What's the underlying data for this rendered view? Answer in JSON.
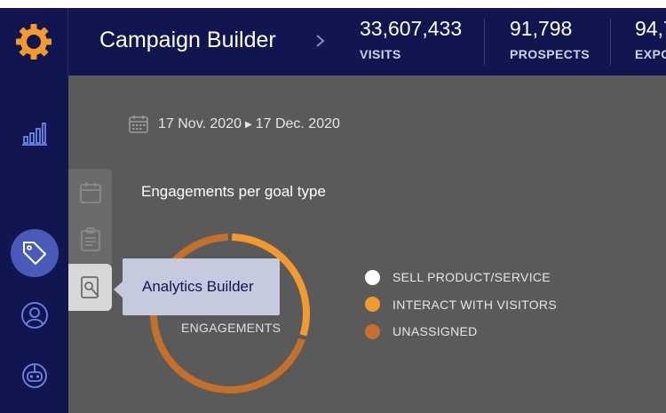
{
  "header": {
    "title": "Campaign Builder",
    "stats": [
      {
        "value": "33,607,433",
        "label": "VISITS"
      },
      {
        "value": "91,798",
        "label": "PROSPECTS"
      },
      {
        "value": "94,7",
        "label": "EXPO"
      }
    ]
  },
  "sidebar": {
    "items": [
      {
        "icon": "bar-chart-icon"
      },
      {
        "icon": "bot-user-icon"
      },
      {
        "icon": "tag-icon",
        "active": true
      },
      {
        "icon": "user-circle-icon"
      },
      {
        "icon": "robot-icon"
      }
    ]
  },
  "subnav": {
    "items": [
      {
        "icon": "calendar-icon"
      },
      {
        "icon": "clipboard-icon"
      },
      {
        "icon": "wrench-document-icon",
        "selected": true
      }
    ],
    "tooltip": "Analytics Builder"
  },
  "date_range": {
    "start": "17 Nov. 2020",
    "end": "17 Dec. 2020"
  },
  "chart": {
    "title": "Engagements per goal type",
    "center_label": "ENGAGEMENTS",
    "legend": [
      {
        "label": "SELL PRODUCT/SERVICE",
        "color": "#ffffff"
      },
      {
        "label": "INTERACT WITH VISITORS",
        "color": "#f39a2e"
      },
      {
        "label": "UNASSIGNED",
        "color": "#c4702b"
      }
    ]
  },
  "chart_data": {
    "type": "pie",
    "title": "Engagements per goal type",
    "categories": [
      "SELL PRODUCT/SERVICE",
      "INTERACT WITH VISITORS",
      "UNASSIGNED"
    ],
    "values": [
      0,
      30,
      70
    ],
    "colors": [
      "#ffffff",
      "#f39a2e",
      "#c4702b"
    ],
    "legend": "right"
  },
  "colors": {
    "brand_navy": "#111650",
    "accent_orange": "#f39a2e",
    "active_nav": "#4b5ab8",
    "content_bg": "#5a5a5a"
  }
}
